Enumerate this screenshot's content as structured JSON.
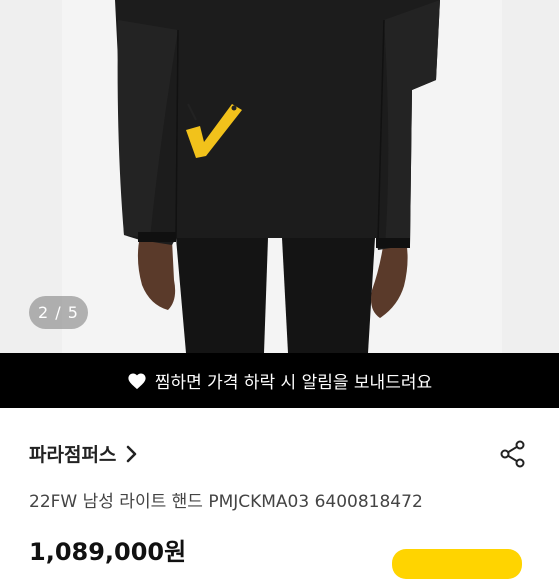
{
  "gallery": {
    "counter": "2 / 5"
  },
  "banner": {
    "text": "찜하면 가격 하락 시 알림을 보내드려요",
    "icon": "heart-icon"
  },
  "shop": {
    "name": "파라점퍼스",
    "icon": "chevron-right-icon"
  },
  "share": {
    "icon": "share-icon"
  },
  "product": {
    "name": "22FW 남성 라이트 핸드 PMJCKMA03 6400818472",
    "price": "1,089,000원"
  },
  "colors": {
    "banner_bg": "#000000",
    "accent": "#ffd400"
  }
}
